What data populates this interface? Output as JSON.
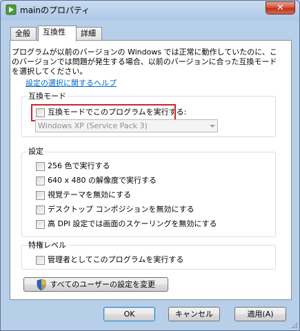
{
  "window": {
    "title": "mainのプロパティ",
    "close_label": "✕"
  },
  "tabs": [
    {
      "label": "全般"
    },
    {
      "label": "互換性"
    },
    {
      "label": "詳細"
    }
  ],
  "compat": {
    "description": "プログラムが以前のバージョンの Windows では正常に動作していたのに、このバージョンでは問題が発生する場合、以前のバージョンに合った互換モードを選択してください。",
    "help_link": "設定の選択に関するヘルプ",
    "mode_group": {
      "label": "互換モード",
      "checkbox_label": "互換モードでこのプログラムを実行する:",
      "select_value": "Windows XP (Service Pack 3)"
    },
    "settings_group": {
      "label": "設定",
      "items": [
        {
          "label": "256 色で実行する"
        },
        {
          "label": "640 x 480 の解像度で実行する"
        },
        {
          "label": "視覚テーマを無効にする"
        },
        {
          "label": "デスクトップ コンポジションを無効にする"
        },
        {
          "label": "高 DPI 設定では画面のスケーリングを無効にする"
        }
      ]
    },
    "privilege_group": {
      "label": "特権レベル",
      "checkbox_label": "管理者としてこのプログラムを実行する"
    },
    "all_users_button": "すべてのユーザーの設定を変更"
  },
  "footer": {
    "ok_label": "OK",
    "cancel_label": "キャンセル",
    "apply_label": "適用(A)"
  }
}
